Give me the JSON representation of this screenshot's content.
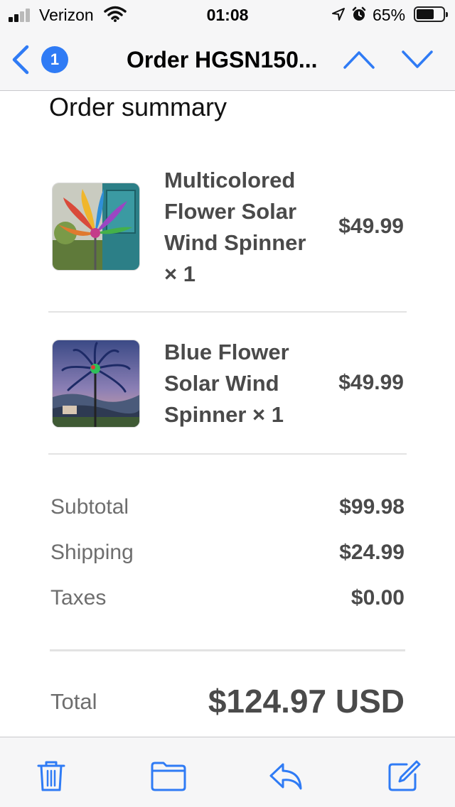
{
  "status_bar": {
    "carrier": "Verizon",
    "time": "01:08",
    "battery_percent": "65%",
    "battery_level": 0.65
  },
  "nav": {
    "unread_count": "1",
    "title": "Order HGSN150..."
  },
  "content": {
    "heading": "Order summary",
    "items": [
      {
        "name": "Multicolored Flower Solar Wind Spinner × 1",
        "price": "$49.99",
        "image": "multicolored-flower-spinner"
      },
      {
        "name": "Blue Flower Solar Wind Spinner × 1",
        "price": "$49.99",
        "image": "blue-flower-spinner"
      }
    ],
    "summary": [
      {
        "label": "Subtotal",
        "value": "$99.98"
      },
      {
        "label": "Shipping",
        "value": "$24.99"
      },
      {
        "label": "Taxes",
        "value": "$0.00"
      }
    ],
    "total": {
      "label": "Total",
      "value": "$124.97 USD"
    }
  },
  "toolbar": {
    "icons": [
      "trash-icon",
      "folder-icon",
      "reply-icon",
      "compose-icon"
    ]
  },
  "colors": {
    "accent": "#2f7bf5",
    "text_dark": "#4a4a4a",
    "text_muted": "#6e6e6e"
  }
}
